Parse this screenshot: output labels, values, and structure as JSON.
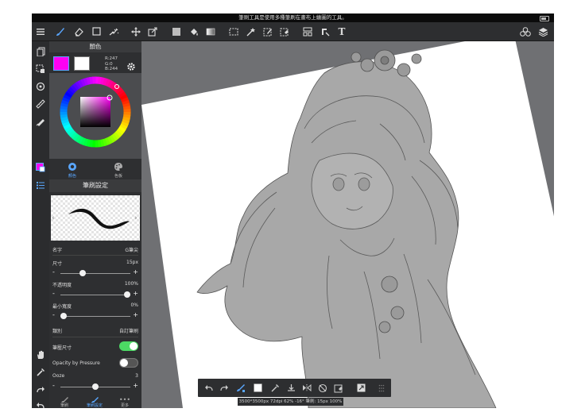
{
  "statusbar": {
    "message": "筆刷工具是使用多種筆刷在畫布上繪圖的工具。"
  },
  "toolbar": {
    "left_tools": [
      "menu-icon",
      "brush-icon",
      "eraser-icon",
      "rect-select-icon",
      "magic-wand-icon"
    ],
    "mid_tools": [
      "move-icon",
      "transform-icon",
      "fill-color-icon",
      "bucket-icon",
      "gradient-icon",
      "select-rect-icon",
      "wand-icon",
      "pen-select-icon",
      "select-erase-icon",
      "frame-icon",
      "ruler-icon"
    ],
    "text_tool_label": "T",
    "right_tools": [
      "materials-icon",
      "layers-icon"
    ]
  },
  "color_panel": {
    "title": "顏色",
    "main_color": "#ff00f4",
    "sub_color": "#ffffff",
    "rgb": {
      "r": "R:247",
      "g": "G:0",
      "b": "B:244"
    },
    "tabs": [
      {
        "label": "顏色"
      },
      {
        "label": "色板"
      }
    ]
  },
  "brush_panel": {
    "title": "筆刷設定",
    "name_label": "名字",
    "name_value": "G筆尖",
    "size_label": "尺寸",
    "size_value": "15px",
    "size_level": 0.3,
    "opacity_label": "不透明度",
    "opacity_value": "100%",
    "opacity_level": 1.0,
    "min_width_label": "最小寬度",
    "min_width_value": "0%",
    "min_width_level": 0.0,
    "category_label": "類別",
    "category_value": "自訂筆刷",
    "pressure_size_label": "筆壓尺寸",
    "pressure_size_on": true,
    "opacity_pressure_label": "Opacity by Pressure",
    "opacity_pressure_on": false,
    "ooze_label": "Ooze",
    "ooze_value": "3",
    "ooze_level": 0.5,
    "accent": "#4cd964"
  },
  "bottom_tabs": [
    {
      "label": "筆刷"
    },
    {
      "label": "筆刷設定"
    },
    {
      "label": "更多"
    }
  ],
  "info_bar": "3500*3500px 72dpi 62% -16° 筆刷: 15px 100%"
}
